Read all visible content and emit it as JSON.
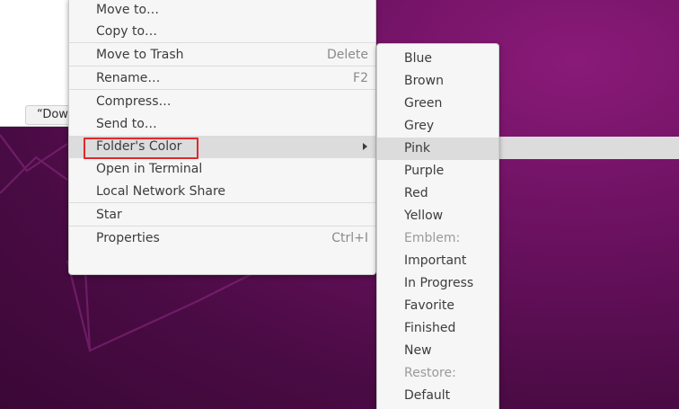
{
  "file_window": {
    "filename_fragment": "“Dow"
  },
  "context_menu": {
    "items": [
      {
        "label": "Move to…",
        "accel": ""
      },
      {
        "label": "Copy to…",
        "accel": ""
      },
      {
        "label": "Move to Trash",
        "accel": "Delete"
      },
      {
        "label": "Rename…",
        "accel": "F2"
      },
      {
        "label": "Compress…",
        "accel": ""
      },
      {
        "label": "Send to…",
        "accel": ""
      },
      {
        "label": "Folder's Color",
        "accel": ""
      },
      {
        "label": "Open in Terminal",
        "accel": ""
      },
      {
        "label": "Local Network Share",
        "accel": ""
      },
      {
        "label": "Star",
        "accel": ""
      },
      {
        "label": "Properties",
        "accel": "Ctrl+I"
      }
    ],
    "hovered_item": "Folder's Color",
    "highlight_color": "#e0282d"
  },
  "folder_color_submenu": {
    "items": [
      {
        "label": "Blue"
      },
      {
        "label": "Brown"
      },
      {
        "label": "Green"
      },
      {
        "label": "Grey"
      },
      {
        "label": "Pink"
      },
      {
        "label": "Purple"
      },
      {
        "label": "Red"
      },
      {
        "label": "Yellow"
      },
      {
        "label": "Emblem:"
      },
      {
        "label": "Important"
      },
      {
        "label": "In Progress"
      },
      {
        "label": "Favorite"
      },
      {
        "label": "Finished"
      },
      {
        "label": "New"
      },
      {
        "label": "Restore:"
      },
      {
        "label": "Default"
      }
    ],
    "hovered_item": "Pink"
  },
  "icons": {
    "submenu_arrow": "chevron-right-icon"
  }
}
